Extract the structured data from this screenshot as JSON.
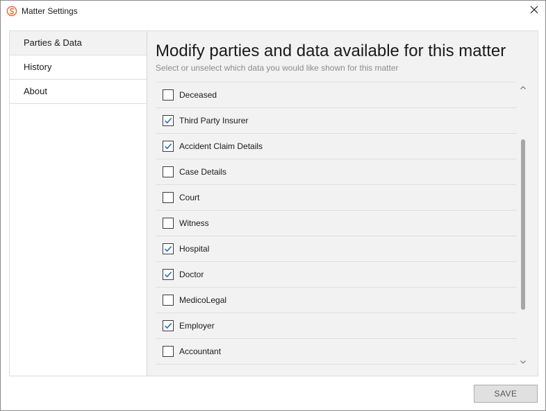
{
  "window": {
    "title": "Matter Settings",
    "app_icon": "app-logo-icon",
    "close_icon": "close-icon"
  },
  "nav": {
    "items": [
      {
        "label": "Parties & Data",
        "active": true
      },
      {
        "label": "History",
        "active": false
      },
      {
        "label": "About",
        "active": false
      }
    ]
  },
  "main": {
    "heading": "Modify parties and data available for this matter",
    "subheading": "Select or unselect which data you would like shown for this matter",
    "items": [
      {
        "label": "Deceased",
        "checked": false
      },
      {
        "label": "Third Party Insurer",
        "checked": true
      },
      {
        "label": "Accident Claim Details",
        "checked": true
      },
      {
        "label": "Case Details",
        "checked": false
      },
      {
        "label": "Court",
        "checked": false
      },
      {
        "label": "Witness",
        "checked": false
      },
      {
        "label": "Hospital",
        "checked": true
      },
      {
        "label": "Doctor",
        "checked": true
      },
      {
        "label": "MedicoLegal",
        "checked": false
      },
      {
        "label": "Employer",
        "checked": true
      },
      {
        "label": "Accountant",
        "checked": false
      }
    ]
  },
  "footer": {
    "save_label": "SAVE"
  },
  "colors": {
    "checkmark": "#2b6cc4",
    "app_icon": "#e8662f",
    "panel_background": "#f2f2f2",
    "save_button": "#e0e0e0"
  }
}
